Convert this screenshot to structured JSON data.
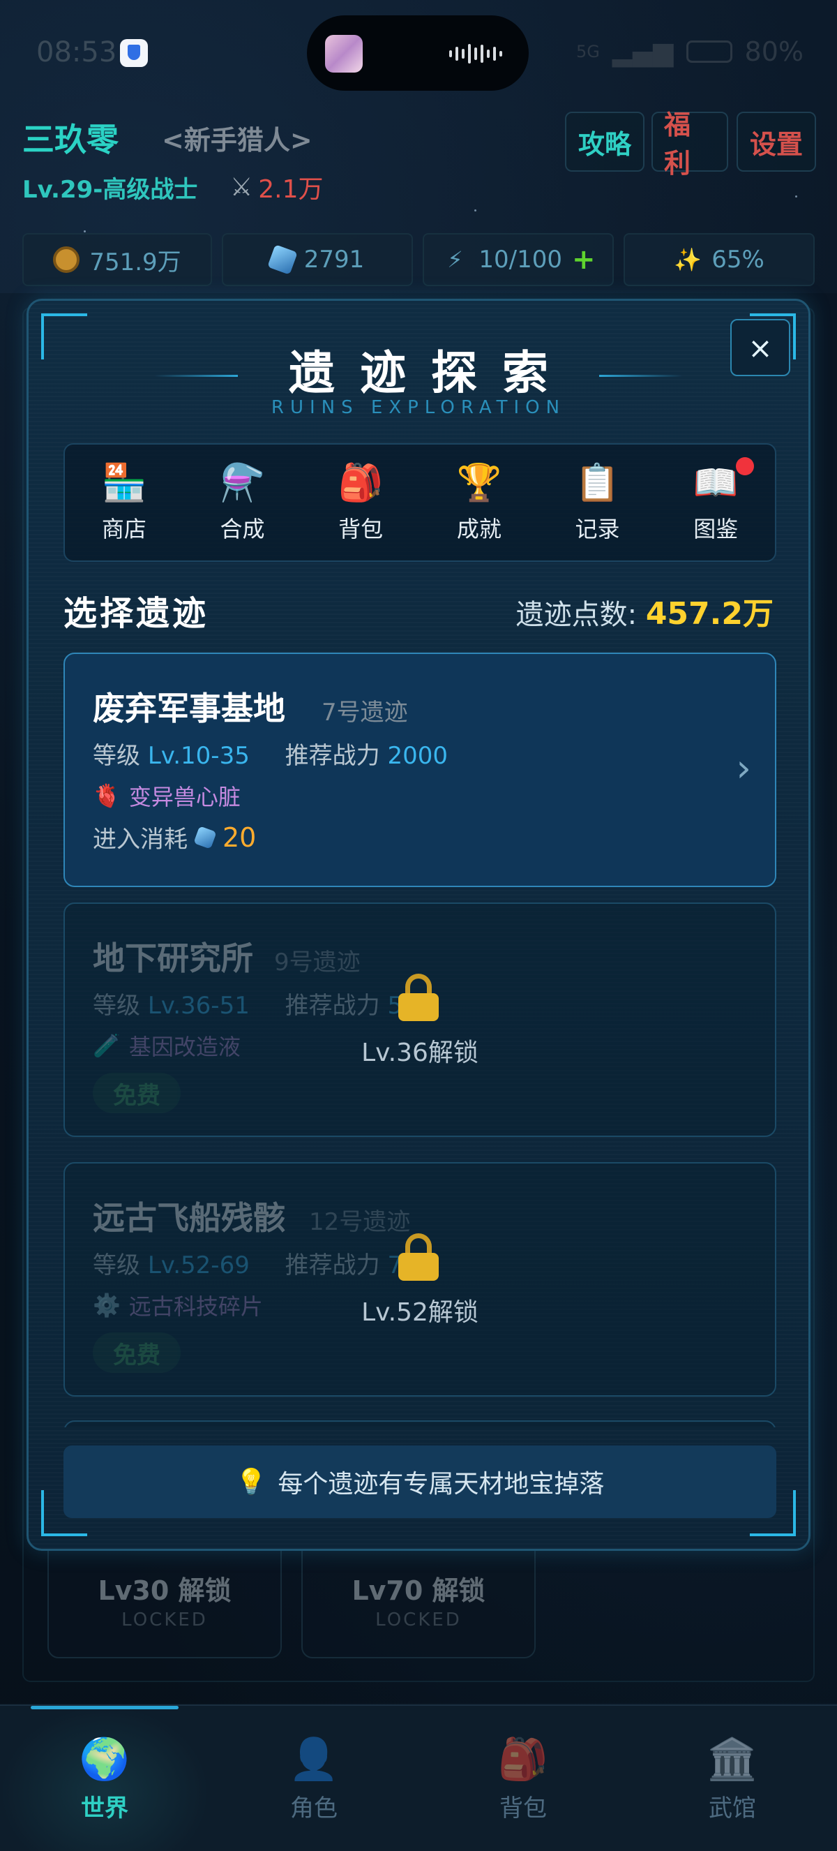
{
  "status_bar": {
    "time": "08:53",
    "battery": "80%",
    "network": "5G"
  },
  "player": {
    "name": "三玖零",
    "title": "<新手猎人>",
    "level": "Lv.29-高级战士",
    "power": "2.1万"
  },
  "header_buttons": {
    "guide": "攻略",
    "welfare": "福利",
    "settings": "设置"
  },
  "resources": {
    "gold": "751.9万",
    "crystal": "2791",
    "energy": "10/100",
    "luck": "65%"
  },
  "background_cards": [
    {
      "label": "Lv30 解锁",
      "sub": "LOCKED"
    },
    {
      "label": "Lv70 解锁",
      "sub": "LOCKED"
    }
  ],
  "modal": {
    "title": "遗迹探索",
    "subtitle": "RUINS EXPLORATION",
    "close": "×",
    "tabs": [
      {
        "label": "商店",
        "icon": "shop-icon",
        "glyph": "🏪"
      },
      {
        "label": "合成",
        "icon": "flask-icon",
        "glyph": "⚗️"
      },
      {
        "label": "背包",
        "icon": "backpack-icon",
        "glyph": "🎒"
      },
      {
        "label": "成就",
        "icon": "trophy-icon",
        "glyph": "🏆"
      },
      {
        "label": "记录",
        "icon": "clipboard-icon",
        "glyph": "📋"
      },
      {
        "label": "图鉴",
        "icon": "book-icon",
        "glyph": "📖"
      }
    ],
    "section_title": "选择遗迹",
    "points_label": "遗迹点数:",
    "points_value": "457.2万",
    "ruins": [
      {
        "name": "废弃军事基地",
        "number": "7号遗迹",
        "level_label": "等级",
        "level": "Lv.10-35",
        "power_label": "推荐战力",
        "power": "2000",
        "drop": "变异兽心脏",
        "drop_glyph": "🫀",
        "cost_label": "进入消耗",
        "cost": "20"
      },
      {
        "name": "地下研究所",
        "number": "9号遗迹",
        "level_label": "等级",
        "level": "Lv.36-51",
        "power_label": "推荐战力",
        "power": "5万",
        "drop": "基因改造液",
        "drop_glyph": "🧪",
        "free": "免费",
        "lock_text": "Lv.36解锁"
      },
      {
        "name": "远古飞船残骸",
        "number": "12号遗迹",
        "level_label": "等级",
        "level": "Lv.52-69",
        "power_label": "推荐战力",
        "power": "7万",
        "drop": "远古科技碎片",
        "drop_glyph": "⚙️",
        "free": "免费",
        "lock_text": "Lv.52解锁"
      }
    ],
    "tip": "每个遗迹有专属天材地宝掉落"
  },
  "bottom_nav": [
    {
      "label": "世界",
      "icon": "globe-icon",
      "glyph": "🌍",
      "active": true
    },
    {
      "label": "角色",
      "icon": "person-icon",
      "glyph": "👤",
      "active": false
    },
    {
      "label": "背包",
      "icon": "backpack-icon",
      "glyph": "🎒",
      "active": false
    },
    {
      "label": "武馆",
      "icon": "temple-icon",
      "glyph": "🏛️",
      "active": false
    }
  ]
}
